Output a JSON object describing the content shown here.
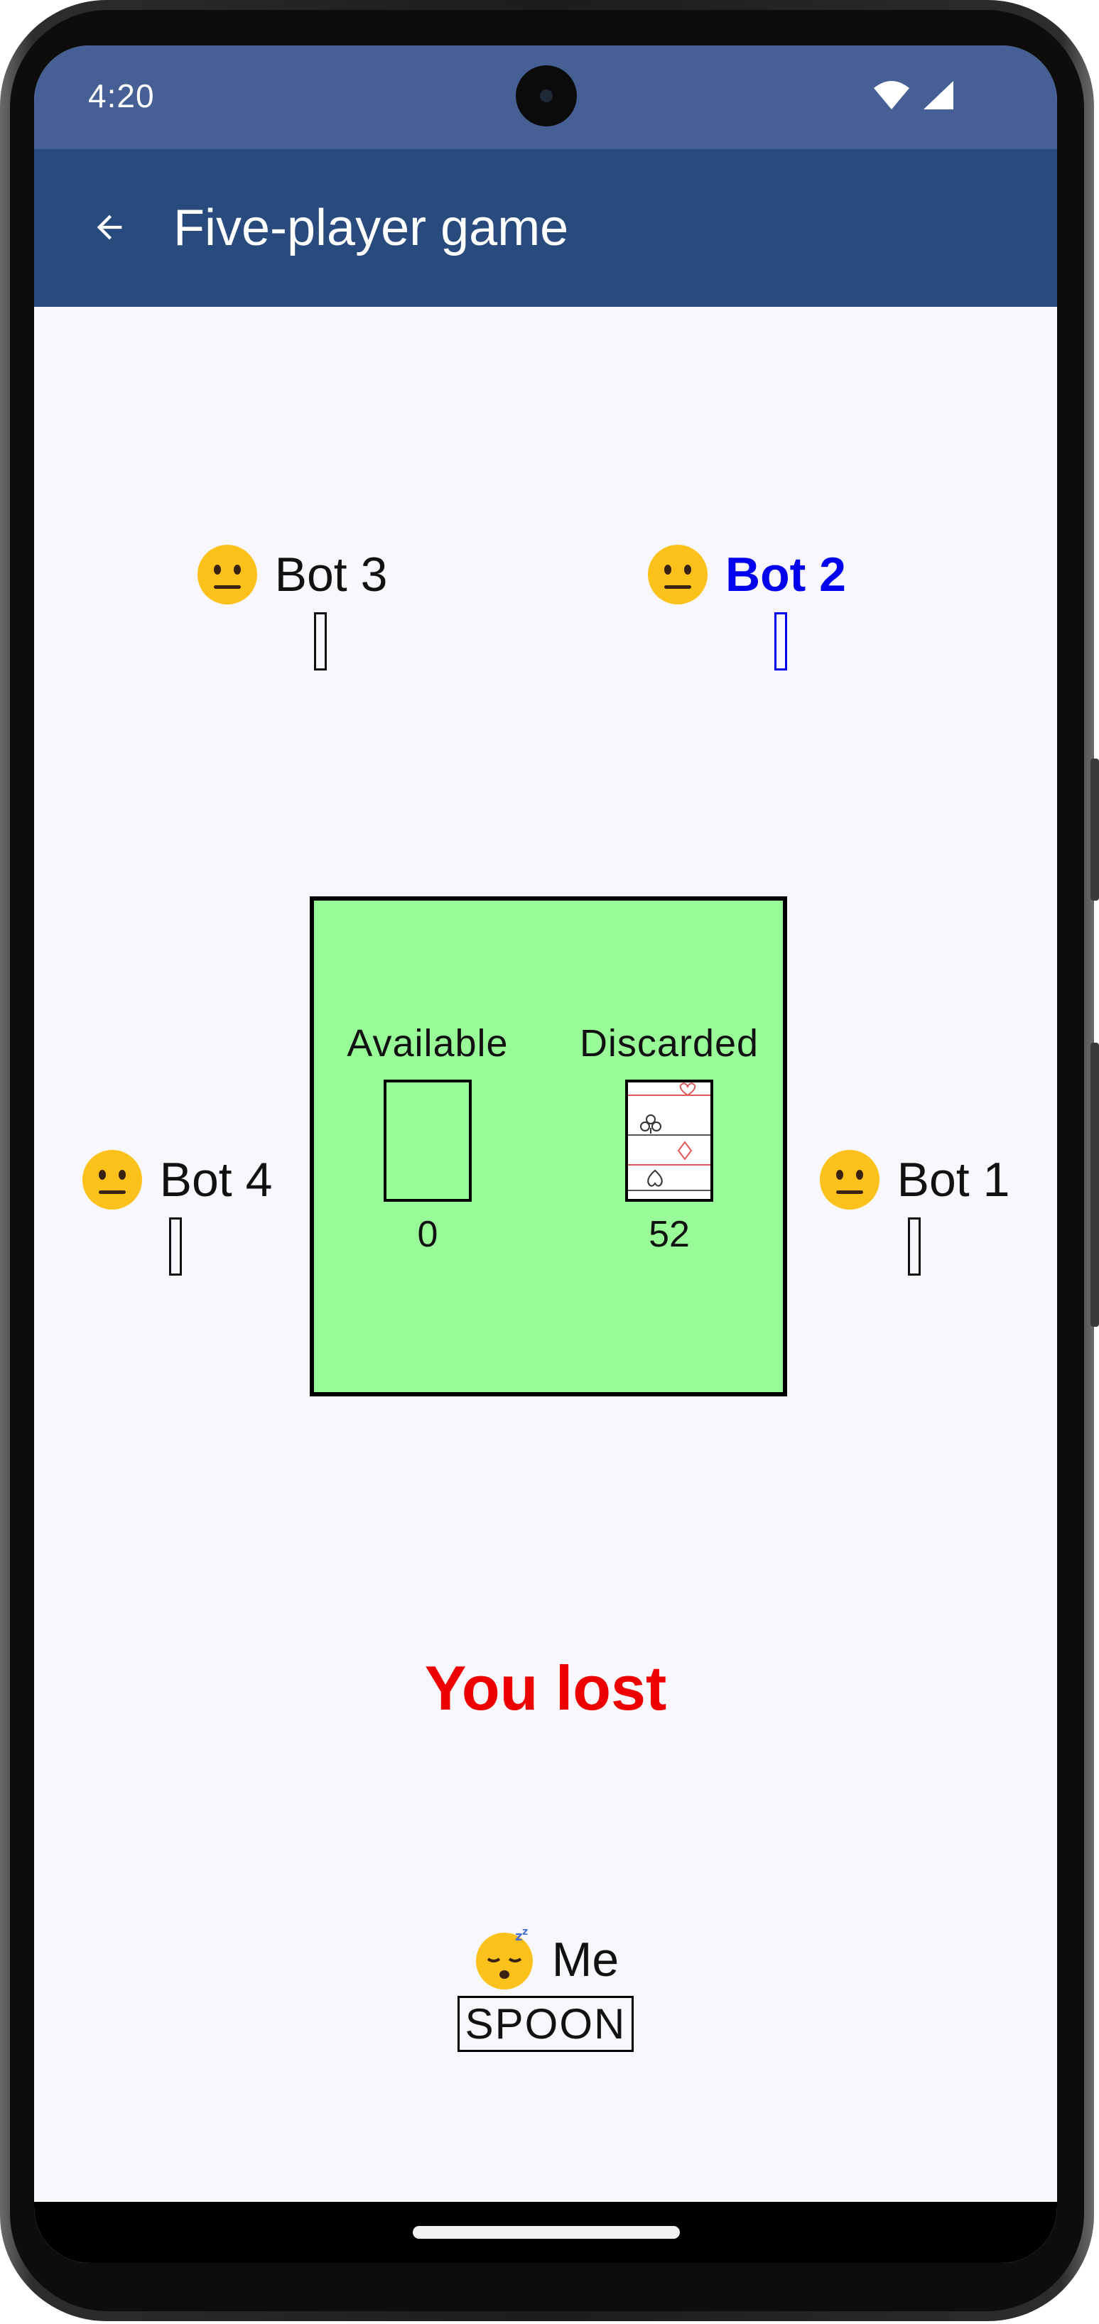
{
  "status_bar": {
    "time": "4:20",
    "icons": [
      "wifi-icon",
      "signal-icon"
    ]
  },
  "app_bar": {
    "back_icon": "arrow-back-icon",
    "title": "Five-player game"
  },
  "players": {
    "bot3": {
      "name": "Bot 3",
      "face": "neutral-face-emoji",
      "active": false
    },
    "bot2": {
      "name": "Bot 2",
      "face": "neutral-face-emoji",
      "active": true
    },
    "bot4": {
      "name": "Bot 4",
      "face": "neutral-face-emoji",
      "active": false
    },
    "bot1": {
      "name": "Bot 1",
      "face": "neutral-face-emoji",
      "active": false
    },
    "me": {
      "name": "Me",
      "face": "sleeping-face-emoji",
      "word": "SPOON"
    }
  },
  "table": {
    "available": {
      "label": "Available",
      "count": "0"
    },
    "discarded": {
      "label": "Discarded",
      "count": "52"
    }
  },
  "result": "You lost",
  "colors": {
    "status_bar": "#465f94",
    "app_bar": "#294a7c",
    "background": "#f8f7fb",
    "table": "#98fb98",
    "active_player": "#0000ee",
    "result": "#ee0000"
  }
}
